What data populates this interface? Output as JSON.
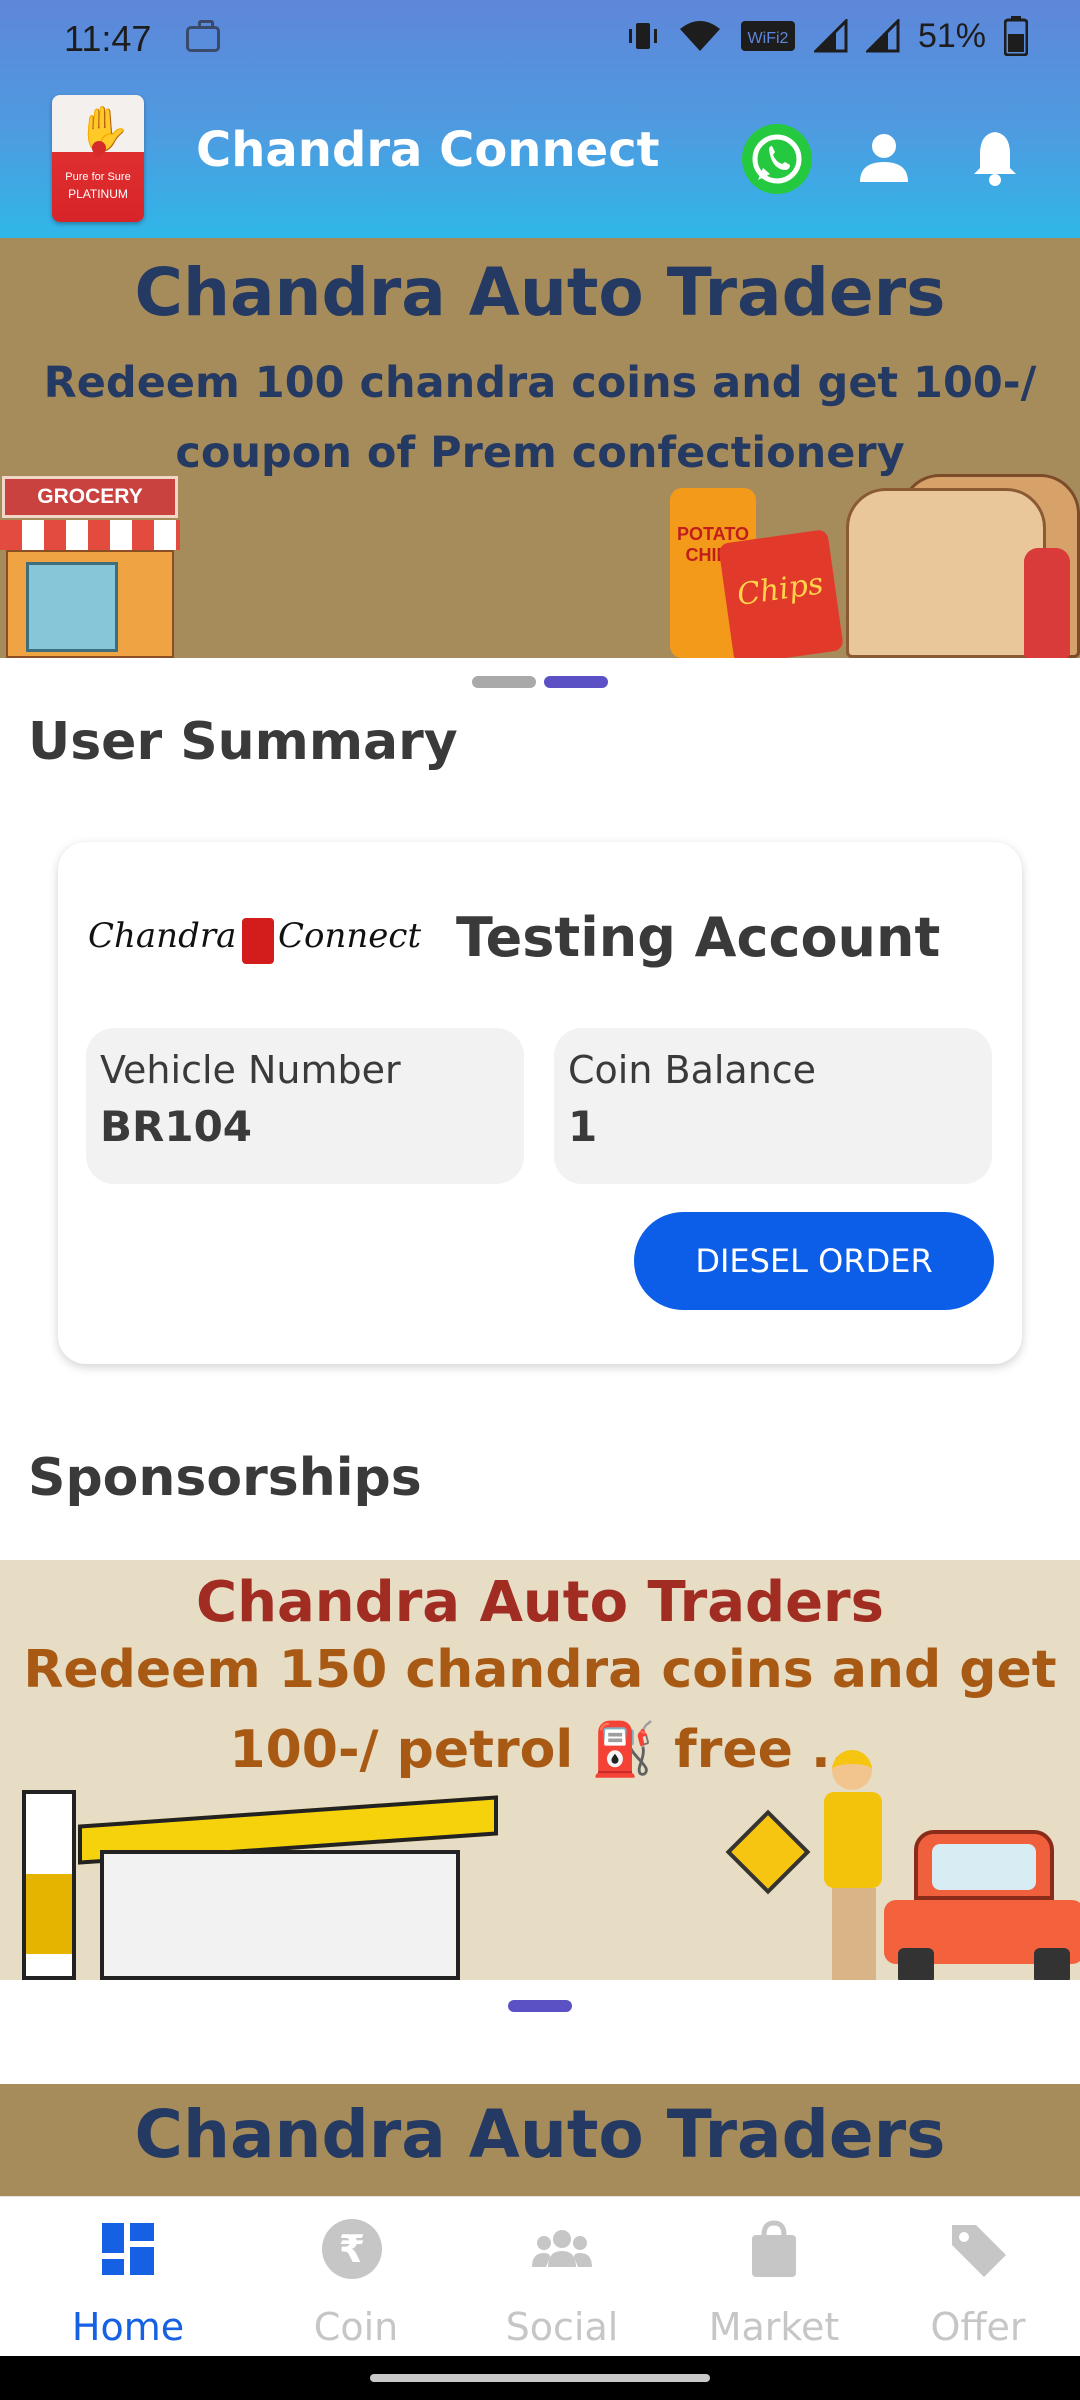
{
  "status_bar": {
    "time": "11:47",
    "battery_percent": "51%",
    "icons": [
      "briefcase-icon",
      "vibrate-icon",
      "wifi-icon",
      "vowifi-icon",
      "signal-icon",
      "signal-icon",
      "battery-icon"
    ]
  },
  "app_bar": {
    "title": "Chandra Connect",
    "logo_text_1": "Pure for Sure",
    "logo_text_2": "PLATINUM",
    "background_gradient": [
      "#5f86da",
      "#2fb7e8"
    ],
    "actions": [
      "whatsapp-icon",
      "profile-icon",
      "bell-icon"
    ]
  },
  "top_banner": {
    "title": "Chandra Auto Traders",
    "subtitle": "Redeem 100 chandra coins and get 100-/ coupon of Prem confectionery",
    "shop_sign": "GROCERY SHOP",
    "can_label": "POTATO CHIPS",
    "bag_label": "Chips",
    "background": "#a68b5b"
  },
  "carousel_1": {
    "count": 2,
    "active_index": 1
  },
  "user_summary": {
    "section_title": "User Summary",
    "brand_logo_left": "Chandra",
    "brand_logo_right": "Connect",
    "account_name": "Testing Account",
    "vehicle_label": "Vehicle Number",
    "vehicle_value": "BR104",
    "coin_label": "Coin Balance",
    "coin_value": "1",
    "diesel_button": "DIESEL ORDER",
    "button_color": "#0c5ee8"
  },
  "sponsorships": {
    "section_title": "Sponsorships",
    "banner_title": "Chandra Auto Traders",
    "banner_sub_line1": "Redeem 150  chandra coins and get",
    "banner_sub_line2": "100-/ petrol ⛽ free ..",
    "background": "#e7dcc4"
  },
  "carousel_2": {
    "count": 1,
    "active_index": 0
  },
  "bottom_banner": {
    "title": "Chandra Auto Traders"
  },
  "bottom_nav": {
    "items": [
      {
        "label": "Home",
        "icon": "dashboard-icon",
        "active": true
      },
      {
        "label": "Coin",
        "icon": "rupee-coin-icon",
        "active": false
      },
      {
        "label": "Social",
        "icon": "group-icon",
        "active": false
      },
      {
        "label": "Market",
        "icon": "shopping-bag-icon",
        "active": false
      },
      {
        "label": "Offer",
        "icon": "tag-icon",
        "active": false
      }
    ],
    "active_color": "#1560e3",
    "inactive_color": "#c6c6c6"
  }
}
